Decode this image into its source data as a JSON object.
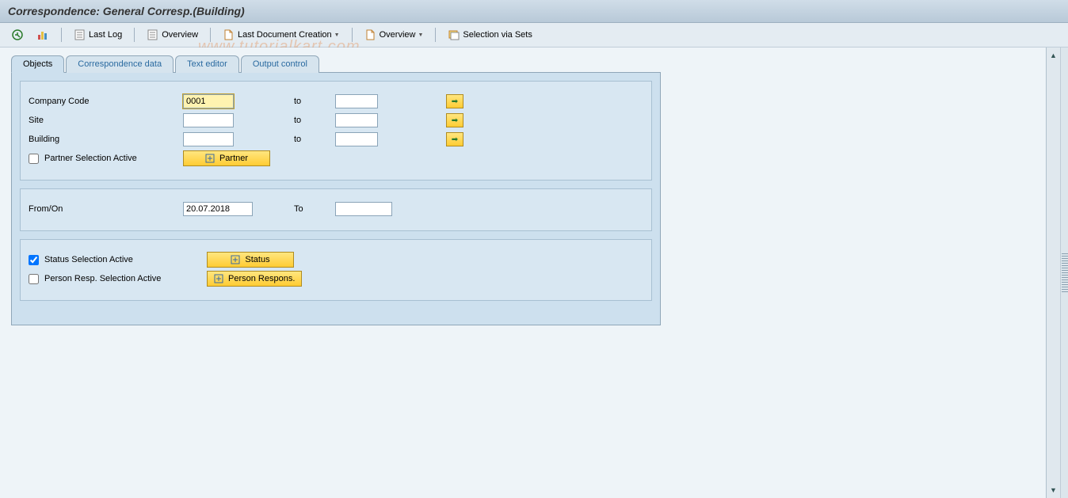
{
  "title": "Correspondence: General Corresp.(Building)",
  "watermark": "www.tutorialkart.com",
  "toolbar": {
    "last_log": "Last Log",
    "overview1": "Overview",
    "last_doc_creation": "Last Document Creation",
    "overview2": "Overview",
    "selection_via_sets": "Selection via Sets"
  },
  "tabs": {
    "objects": "Objects",
    "correspondence_data": "Correspondence data",
    "text_editor": "Text editor",
    "output_control": "Output control"
  },
  "section1": {
    "labels": {
      "company_code": "Company Code",
      "site": "Site",
      "building": "Building",
      "partner_sel_active": "Partner Selection Active",
      "to": "to"
    },
    "values": {
      "company_code_from": "0001",
      "company_code_to": "",
      "site_from": "",
      "site_to": "",
      "building_from": "",
      "building_to": ""
    },
    "buttons": {
      "partner": "Partner"
    }
  },
  "section2": {
    "labels": {
      "from_on": "From/On",
      "to": "To"
    },
    "values": {
      "from_date": "20.07.2018",
      "to_date": ""
    }
  },
  "section3": {
    "labels": {
      "status_sel_active": "Status Selection Active",
      "person_resp_sel_active": "Person Resp. Selection Active"
    },
    "buttons": {
      "status": "Status",
      "person_respons": "Person Respons."
    }
  }
}
